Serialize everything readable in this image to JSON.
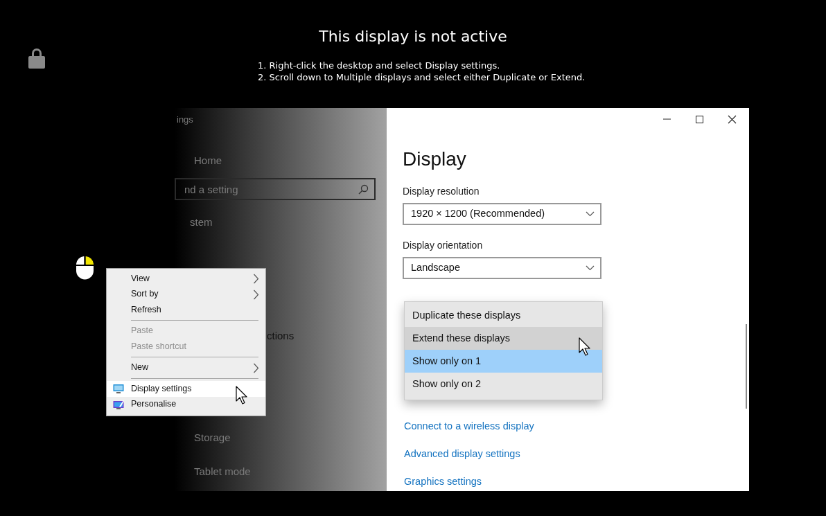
{
  "header": {
    "title": "This display is not active",
    "steps": [
      "1. Right-click the desktop and select Display settings.",
      "2. Scroll down to Multiple displays and select either Duplicate or Extend."
    ]
  },
  "settings_window": {
    "sidebar": {
      "title": "ings",
      "home": "Home",
      "search": {
        "placeholder": "nd a setting"
      },
      "section": "stem",
      "items": [
        "ctions",
        "Storage",
        "Tablet mode"
      ]
    },
    "title": "Display",
    "fields": [
      {
        "label": "Display resolution",
        "value": "1920 × 1200 (Recommended)"
      },
      {
        "label": "Display orientation",
        "value": "Landscape"
      }
    ],
    "multiple_displays_options": [
      {
        "label": "Duplicate these displays",
        "selected": false,
        "hovered": false
      },
      {
        "label": "Extend these displays",
        "selected": false,
        "hovered": true
      },
      {
        "label": "Show only on 1",
        "selected": true,
        "hovered": false
      },
      {
        "label": "Show only on 2",
        "selected": false,
        "hovered": false
      }
    ],
    "links": [
      "Connect to a wireless display",
      "Advanced display settings",
      "Graphics settings"
    ]
  },
  "context_menu": [
    {
      "kind": "submenu",
      "label": "View",
      "disabled": false,
      "selected": false
    },
    {
      "kind": "submenu",
      "label": "Sort by",
      "disabled": false,
      "selected": false
    },
    {
      "kind": "plain",
      "label": "Refresh",
      "disabled": false,
      "selected": false
    },
    {
      "kind": "separator"
    },
    {
      "kind": "plain",
      "label": "Paste",
      "disabled": true,
      "selected": false
    },
    {
      "kind": "plain",
      "label": "Paste shortcut",
      "disabled": true,
      "selected": false
    },
    {
      "kind": "separator"
    },
    {
      "kind": "submenu",
      "label": "New",
      "disabled": false,
      "selected": false
    },
    {
      "kind": "separator"
    },
    {
      "kind": "icon",
      "label": "Display settings",
      "disabled": false,
      "selected": true
    },
    {
      "kind": "icon",
      "label": "Personalise",
      "disabled": false,
      "selected": false
    }
  ]
}
